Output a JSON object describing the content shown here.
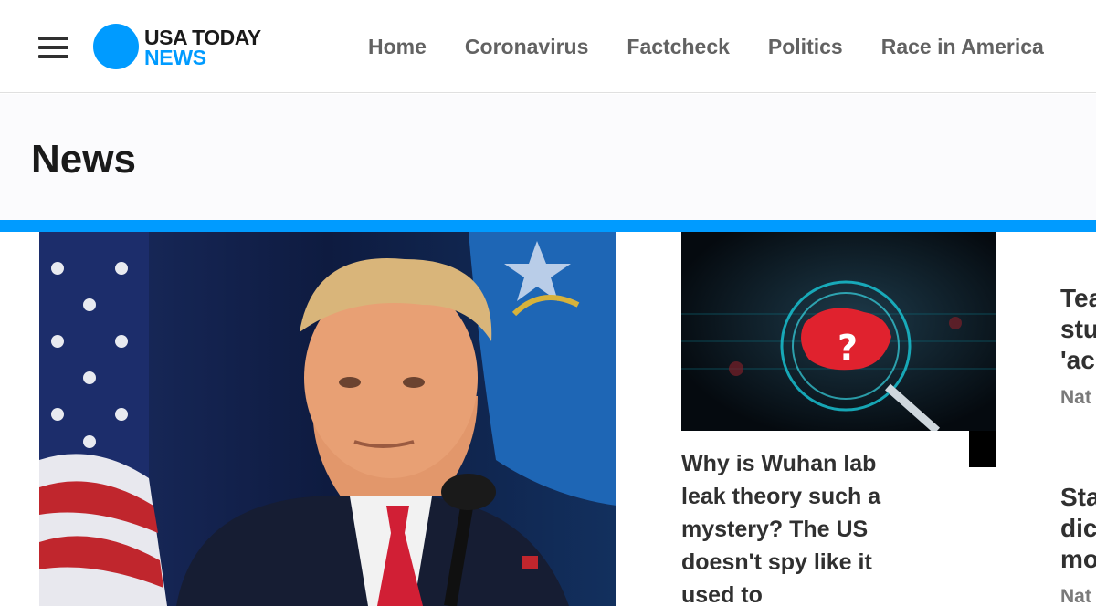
{
  "header": {
    "logo_top": "USA TODAY",
    "logo_bottom": "NEWS",
    "nav": [
      "Home",
      "Coronavirus",
      "Factcheck",
      "Politics",
      "Race in America"
    ]
  },
  "page": {
    "title": "News"
  },
  "stories": {
    "hero_icon": "trump-photo",
    "card2": {
      "image_icon": "china-map-magnifier",
      "title": "Why is Wuhan lab leak theory such a mystery? The US doesn't spy like it used to"
    },
    "side": [
      {
        "lines": [
          "Tea",
          "stu",
          "'ac"
        ],
        "label": "Nat"
      },
      {
        "lines": [
          "Sta",
          "dic",
          "mo"
        ],
        "label": "Nat"
      }
    ]
  },
  "colors": {
    "accent": "#009bff",
    "text": "#303030",
    "nav": "#626262"
  }
}
